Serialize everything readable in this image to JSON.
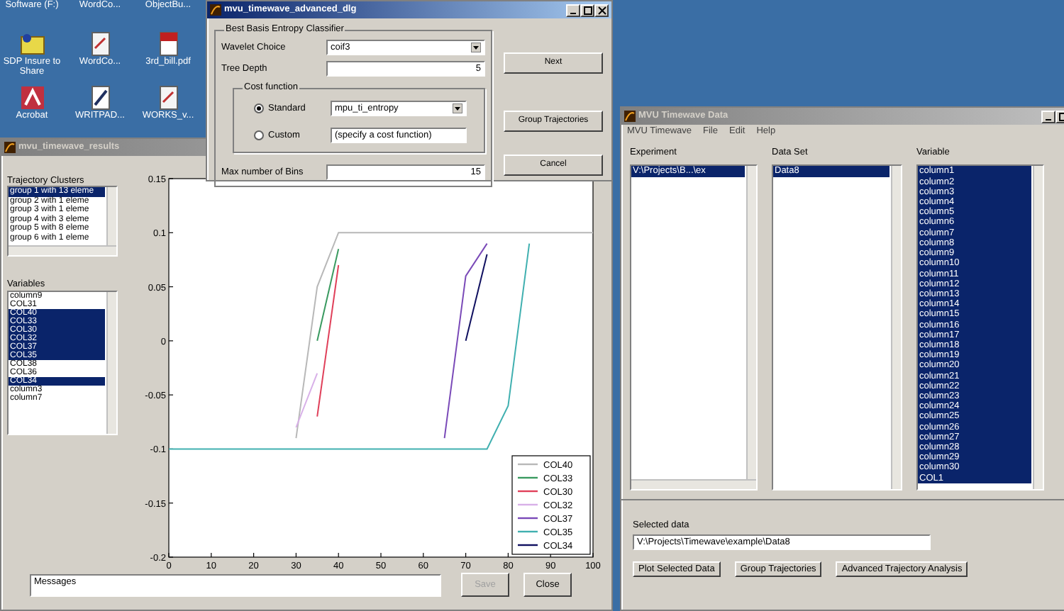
{
  "desktop_icons": [
    {
      "label": "Software (F:)",
      "kind": "label_only"
    },
    {
      "label": "WordCo...",
      "kind": "label_only"
    },
    {
      "label": "ObjectBu...",
      "kind": "label_only"
    },
    {
      "label": "SDP Insure to Share",
      "kind": "folder"
    },
    {
      "label": "WordCo...",
      "kind": "document"
    },
    {
      "label": "3rd_bill.pdf",
      "kind": "pdf"
    },
    {
      "label": "Acrobat",
      "kind": "app"
    },
    {
      "label": "WRITPAD...",
      "kind": "pen"
    },
    {
      "label": "WORKS_v...",
      "kind": "document"
    }
  ],
  "results_window": {
    "title": "mvu_timewave_results",
    "active": false,
    "clusters_label": "Trajectory Clusters",
    "clusters": [
      {
        "label": "group 1 with 13 eleme",
        "selected": true
      },
      {
        "label": "group 2 with 1 eleme",
        "selected": false
      },
      {
        "label": "group 3 with 1 eleme",
        "selected": false
      },
      {
        "label": "group 4 with 3 eleme",
        "selected": false
      },
      {
        "label": "group 5 with 8 eleme",
        "selected": false
      },
      {
        "label": "group 6 with 1 eleme",
        "selected": false
      }
    ],
    "variables_label": "Variables",
    "variables": [
      {
        "label": "column9",
        "selected": false
      },
      {
        "label": "COL31",
        "selected": false
      },
      {
        "label": "COL40",
        "selected": true
      },
      {
        "label": "COL33",
        "selected": true
      },
      {
        "label": "COL30",
        "selected": true
      },
      {
        "label": "COL32",
        "selected": true
      },
      {
        "label": "COL37",
        "selected": true
      },
      {
        "label": "COL35",
        "selected": true
      },
      {
        "label": "COL38",
        "selected": false
      },
      {
        "label": "COL36",
        "selected": false
      },
      {
        "label": "COL34",
        "selected": true
      },
      {
        "label": "column3",
        "selected": false
      },
      {
        "label": "column7",
        "selected": false
      }
    ],
    "chart_data": {
      "type": "line",
      "x": [
        0,
        5,
        10,
        15,
        20,
        25,
        30,
        35,
        40,
        45,
        50,
        55,
        60,
        65,
        70,
        75,
        80,
        85,
        90,
        95,
        100
      ],
      "xlim": [
        0,
        100
      ],
      "ylim": [
        -0.2,
        0.15
      ],
      "xticks": [
        0,
        10,
        20,
        30,
        40,
        50,
        60,
        70,
        80,
        90,
        100
      ],
      "yticks": [
        0.15,
        0.1,
        0.05,
        0,
        -0.05,
        -0.1,
        -0.15,
        -0.2
      ],
      "series": [
        {
          "name": "COL40",
          "color": "#b8b8b8",
          "values": [
            null,
            null,
            null,
            null,
            null,
            null,
            -0.09,
            0.05,
            0.1,
            0.1,
            0.1,
            0.1,
            0.1,
            0.1,
            0.1,
            0.1,
            0.1,
            0.1,
            0.1,
            0.1,
            0.1
          ]
        },
        {
          "name": "COL33",
          "color": "#3a9a60",
          "values": [
            null,
            null,
            null,
            null,
            null,
            null,
            null,
            0.0,
            0.085,
            null,
            null,
            null,
            null,
            null,
            null,
            null,
            null,
            null,
            null,
            null,
            null
          ]
        },
        {
          "name": "COL30",
          "color": "#e0405a",
          "values": [
            null,
            null,
            null,
            null,
            null,
            null,
            null,
            -0.07,
            0.07,
            null,
            null,
            null,
            null,
            null,
            null,
            null,
            null,
            null,
            null,
            null,
            null
          ]
        },
        {
          "name": "COL32",
          "color": "#d8b0e8",
          "values": [
            null,
            null,
            null,
            null,
            null,
            null,
            -0.08,
            -0.03,
            null,
            null,
            null,
            null,
            null,
            null,
            null,
            null,
            null,
            null,
            null,
            null,
            null
          ]
        },
        {
          "name": "COL37",
          "color": "#7a4ab8",
          "values": [
            null,
            null,
            null,
            null,
            null,
            null,
            null,
            null,
            null,
            null,
            null,
            null,
            null,
            -0.09,
            0.06,
            0.09,
            null,
            null,
            null,
            null,
            null
          ]
        },
        {
          "name": "COL35",
          "color": "#40b0b0",
          "values": [
            -0.1,
            -0.1,
            -0.1,
            -0.1,
            -0.1,
            -0.1,
            -0.1,
            -0.1,
            -0.1,
            -0.1,
            -0.1,
            -0.1,
            -0.1,
            -0.1,
            -0.1,
            -0.1,
            -0.06,
            0.09,
            null,
            null,
            null
          ]
        },
        {
          "name": "COL34",
          "color": "#101060",
          "values": [
            null,
            null,
            null,
            null,
            null,
            null,
            null,
            null,
            null,
            null,
            null,
            null,
            null,
            null,
            0.0,
            0.08,
            null,
            null,
            null,
            null,
            null
          ]
        }
      ],
      "legend": "lower right"
    },
    "messages": "Messages",
    "buttons": [
      {
        "label": "Save",
        "disabled": true
      },
      {
        "label": "Close",
        "disabled": false
      }
    ]
  },
  "dialog": {
    "title": "mvu_timewave_advanced_dlg",
    "active": true,
    "group_label": "Best Basis Entropy Classifier",
    "wavelet_label": "Wavelet Choice",
    "wavelet_value": "coif3",
    "tree_depth_label": "Tree Depth",
    "tree_depth_value": "5",
    "cost_label": "Cost function",
    "cost_options": [
      {
        "label": "Standard",
        "selected": true,
        "kind": "select",
        "value": "mpu_ti_entropy"
      },
      {
        "label": "Custom",
        "selected": false,
        "kind": "input",
        "value": "(specify a cost function)"
      }
    ],
    "bins_label": "Max number of Bins",
    "bins_value": "15",
    "buttons": [
      "Next",
      "Group Trajectories",
      "Cancel"
    ]
  },
  "data_window": {
    "title": "MVU Timewave Data",
    "active": false,
    "menu": [
      "MVU Timewave",
      "File",
      "Edit",
      "Help"
    ],
    "columns": [
      {
        "label": "Experiment",
        "items": [
          {
            "label": "V:\\Projects\\B...\\ex",
            "selected": true
          }
        ]
      },
      {
        "label": "Data Set",
        "items": [
          {
            "label": "Data8",
            "selected": true
          }
        ]
      },
      {
        "label": "Variable",
        "items": [
          {
            "label": "column1",
            "selected": true
          },
          {
            "label": "column2",
            "selected": true
          },
          {
            "label": "column3",
            "selected": true
          },
          {
            "label": "column4",
            "selected": true
          },
          {
            "label": "column5",
            "selected": true
          },
          {
            "label": "column6",
            "selected": true
          },
          {
            "label": "column7",
            "selected": true
          },
          {
            "label": "column8",
            "selected": true
          },
          {
            "label": "column9",
            "selected": true
          },
          {
            "label": "column10",
            "selected": true
          },
          {
            "label": "column11",
            "selected": true
          },
          {
            "label": "column12",
            "selected": true
          },
          {
            "label": "column13",
            "selected": true
          },
          {
            "label": "column14",
            "selected": true
          },
          {
            "label": "column15",
            "selected": true
          },
          {
            "label": "column16",
            "selected": true
          },
          {
            "label": "column17",
            "selected": true
          },
          {
            "label": "column18",
            "selected": true
          },
          {
            "label": "column19",
            "selected": true
          },
          {
            "label": "column20",
            "selected": true
          },
          {
            "label": "column21",
            "selected": true
          },
          {
            "label": "column22",
            "selected": true
          },
          {
            "label": "column23",
            "selected": true
          },
          {
            "label": "column24",
            "selected": true
          },
          {
            "label": "column25",
            "selected": true
          },
          {
            "label": "column26",
            "selected": true
          },
          {
            "label": "column27",
            "selected": true
          },
          {
            "label": "column28",
            "selected": true
          },
          {
            "label": "column29",
            "selected": true
          },
          {
            "label": "column30",
            "selected": true
          },
          {
            "label": "COL1",
            "selected": true
          }
        ]
      }
    ],
    "selected_label": "Selected data",
    "selected_value": "V:\\Projects\\Timewave\\example\\Data8",
    "buttons": [
      "Plot Selected Data",
      "Group Trajectories",
      "Advanced Trajectory Analysis"
    ]
  }
}
